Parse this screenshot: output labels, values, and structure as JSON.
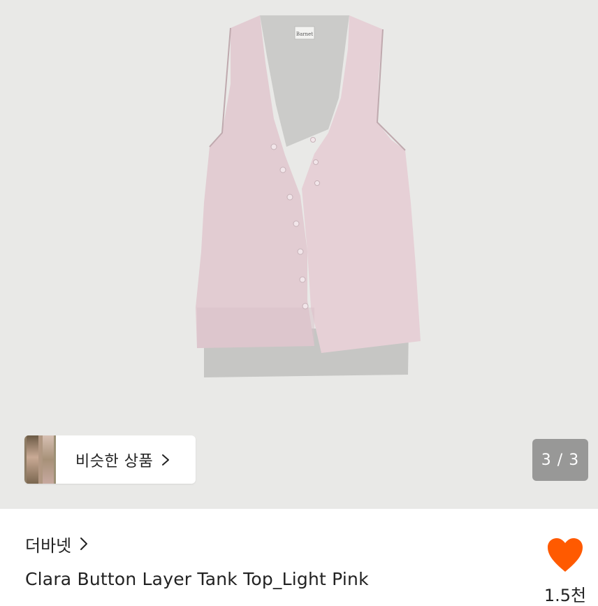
{
  "gallery": {
    "image_alt": "Clara Button Layer Tank Top_Light Pink",
    "garment_colors": {
      "background": "#e9e9e7",
      "outer_pink": "#e3cdd3",
      "inner_gray": "#c9c9c9"
    },
    "counter_current": 3,
    "counter_total": 3,
    "counter_text": "3 / 3",
    "tag_text": "Barnet"
  },
  "similar": {
    "label": "비슷한 상품",
    "chevron_icon": "chevron-right-icon"
  },
  "product": {
    "store_name": "더바넷",
    "title": "Clara Button Layer Tank Top_Light Pink",
    "likes_count": "1.5천",
    "like_icon": "heart-icon",
    "like_color": "#ff5a00"
  }
}
